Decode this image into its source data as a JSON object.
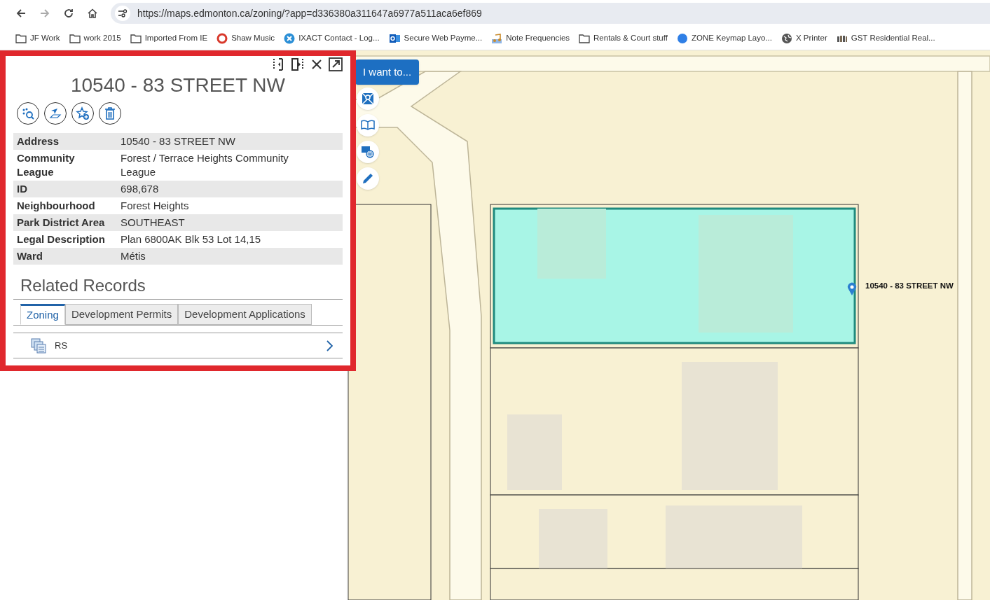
{
  "browser": {
    "url": "https://maps.edmonton.ca/zoning/?app=d336380a311647a6977a511aca6ef869",
    "bookmarks": [
      {
        "label": "JF Work",
        "kind": "folder"
      },
      {
        "label": "work 2015",
        "kind": "folder"
      },
      {
        "label": "Imported From IE",
        "kind": "folder"
      },
      {
        "label": "Shaw Music",
        "kind": "ring"
      },
      {
        "label": "IXACT Contact - Log...",
        "kind": "cross"
      },
      {
        "label": "Secure Web Payme...",
        "kind": "mail"
      },
      {
        "label": "Note Frequencies",
        "kind": "note"
      },
      {
        "label": "Rentals & Court stuff",
        "kind": "folder"
      },
      {
        "label": "ZONE Keymap Layo...",
        "kind": "dot"
      },
      {
        "label": "X Printer",
        "kind": "globe"
      },
      {
        "label": "GST Residential Real...",
        "kind": "bars"
      }
    ]
  },
  "panel": {
    "title": "10540 - 83 STREET NW",
    "details": [
      {
        "label": "Address",
        "value": "10540 - 83 STREET NW"
      },
      {
        "label": "Community League",
        "value": "Forest / Terrace Heights Community League"
      },
      {
        "label": "ID",
        "value": "698,678"
      },
      {
        "label": "Neighbourhood",
        "value": "Forest Heights"
      },
      {
        "label": "Park District Area",
        "value": "SOUTHEAST"
      },
      {
        "label": "Legal Description",
        "value": "Plan 6800AK Blk 53 Lot 14,15"
      },
      {
        "label": "Ward",
        "value": "Métis"
      }
    ],
    "related_title": "Related Records",
    "tabs": [
      {
        "label": "Zoning",
        "selected": true
      },
      {
        "label": "Development Permits",
        "selected": false
      },
      {
        "label": "Development Applications",
        "selected": false
      }
    ],
    "records": [
      {
        "label": "RS"
      }
    ]
  },
  "map": {
    "menu_button": "I want to...",
    "pin_label": "10540 - 83 STREET NW"
  }
}
